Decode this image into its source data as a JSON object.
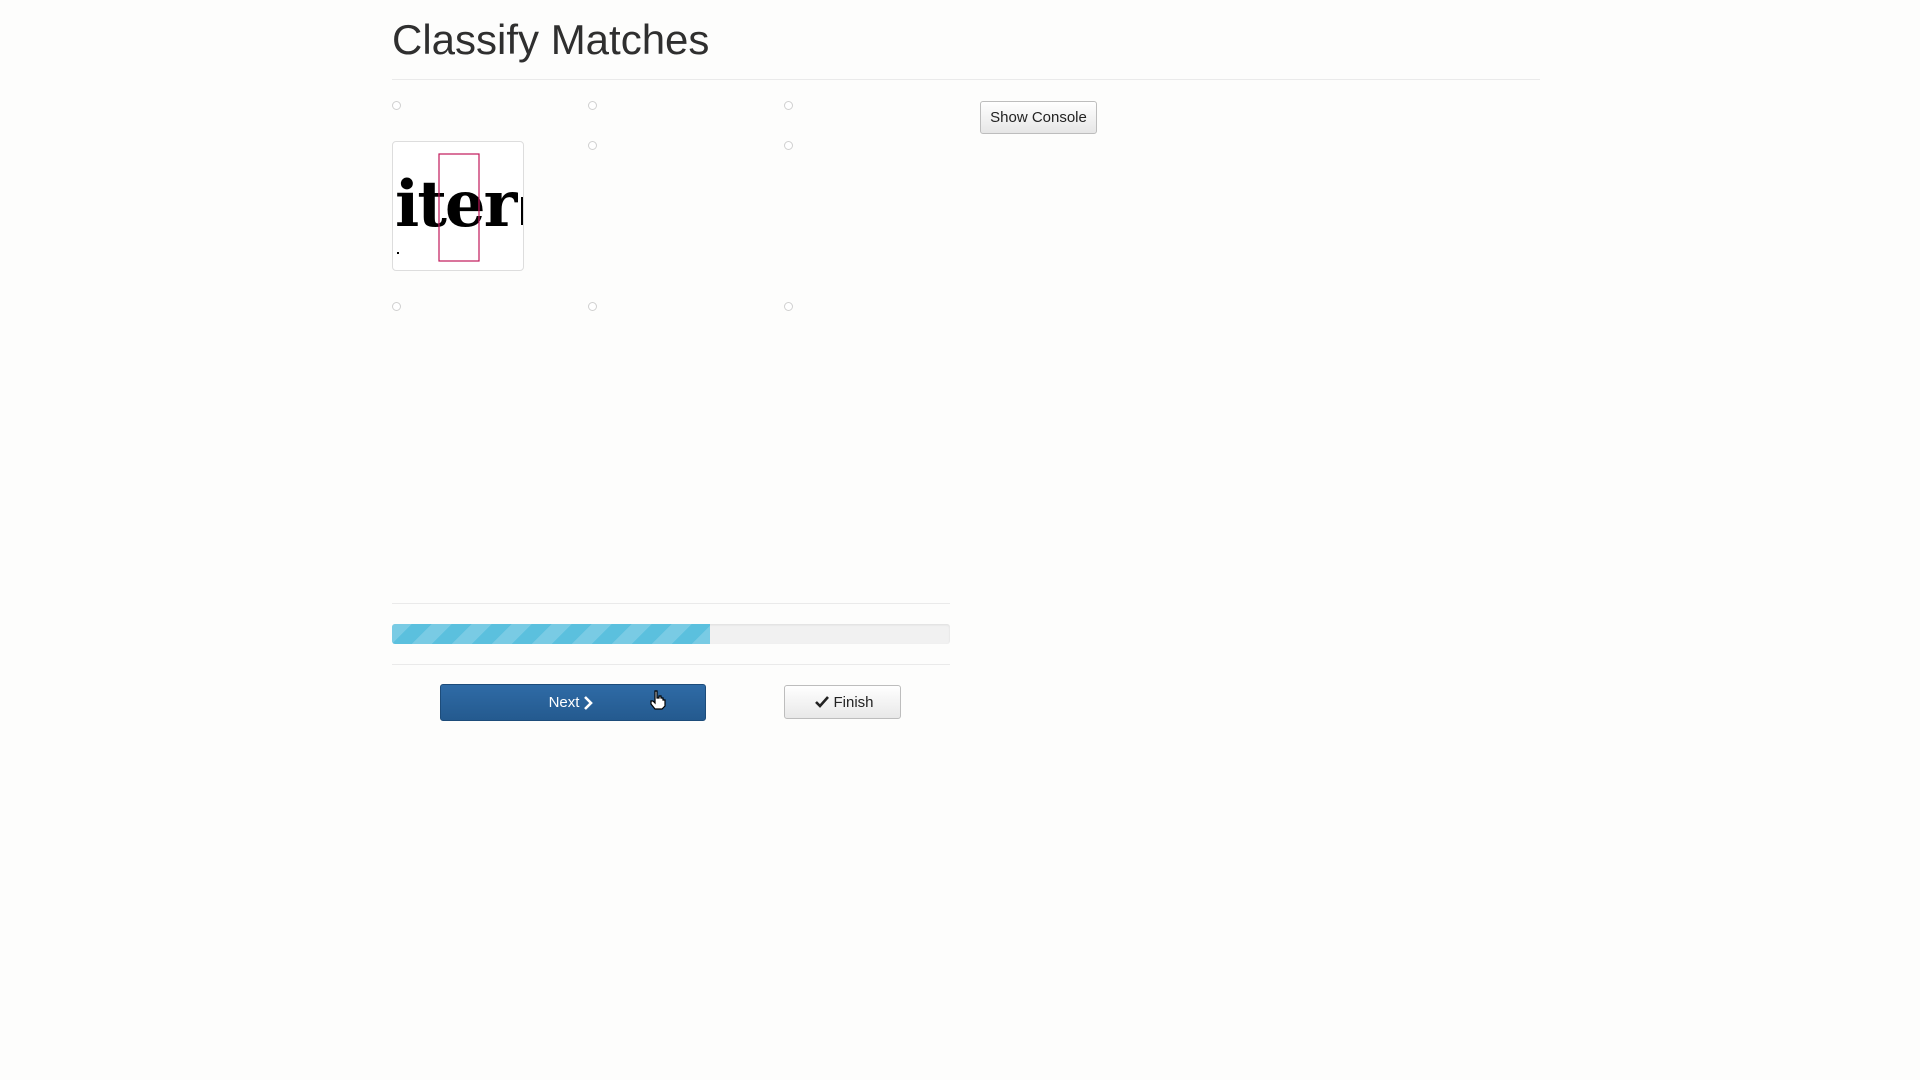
{
  "page": {
    "title": "Classify Matches"
  },
  "toolbar": {
    "show_console_label": "Show Console"
  },
  "match_image": {
    "glyph_text": "iter",
    "highlight_color": "#c2185b"
  },
  "progress": {
    "value_percent": 57
  },
  "actions": {
    "next_label": "Next",
    "finish_label": "Finish"
  },
  "icons": {
    "next": "chevron-right-icon",
    "finish": "check-icon",
    "cursor": "hand-pointer-icon"
  },
  "colors": {
    "primary": "#245a8f",
    "progress": "#5bc0de"
  }
}
